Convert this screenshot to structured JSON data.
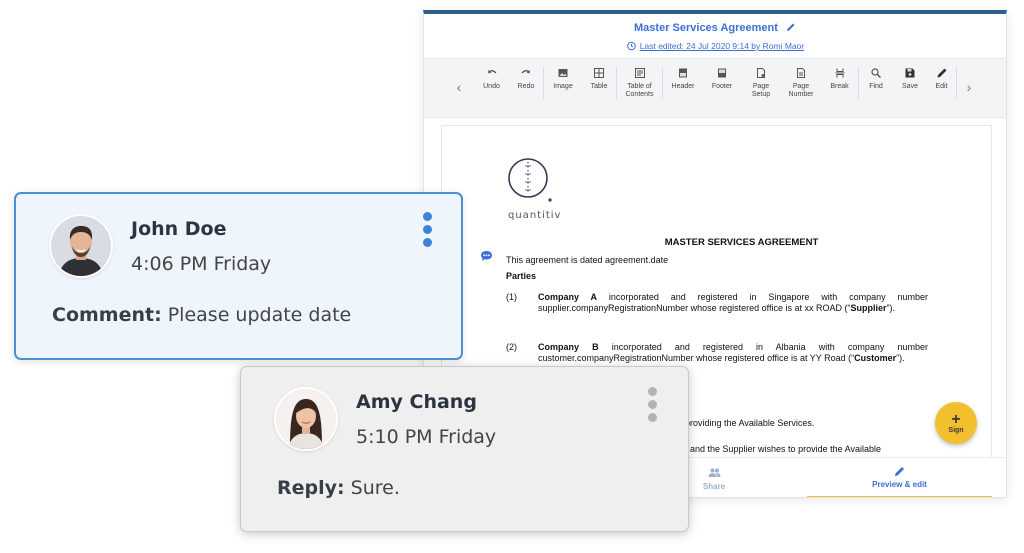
{
  "editor": {
    "doc_title": "Master Services Agreement",
    "last_edited": "Last edited: 24 Jul 2020 9:14 by Romi Maor",
    "toolbar": [
      {
        "id": "undo",
        "label": "Undo",
        "icon": "undo-icon"
      },
      {
        "id": "redo",
        "label": "Redo",
        "icon": "redo-icon"
      },
      {
        "id": "image",
        "label": "Image",
        "icon": "image-icon"
      },
      {
        "id": "table",
        "label": "Table",
        "icon": "table-icon"
      },
      {
        "id": "toc",
        "label": "Table of\nContents",
        "icon": "toc-icon"
      },
      {
        "id": "header",
        "label": "Header",
        "icon": "header-icon"
      },
      {
        "id": "footer",
        "label": "Footer",
        "icon": "footer-icon"
      },
      {
        "id": "page-setup",
        "label": "Page\nSetup",
        "icon": "page-setup-icon"
      },
      {
        "id": "page-number",
        "label": "Page\nNumber",
        "icon": "page-number-icon"
      },
      {
        "id": "break",
        "label": "Break",
        "icon": "break-icon"
      },
      {
        "id": "find",
        "label": "Find",
        "icon": "search-icon"
      },
      {
        "id": "save",
        "label": "Save",
        "icon": "save-icon"
      },
      {
        "id": "edit",
        "label": "Edit",
        "icon": "pencil-icon"
      }
    ],
    "document": {
      "logo_text": "quantitiv",
      "heading": "MASTER SERVICES AGREEMENT",
      "dated": "This agreement is dated agreement.date",
      "parties_label": "Parties",
      "clause1_num": "(1)",
      "clause1_bold": "Company A",
      "clause1_text": " incorporated and registered in Singapore with company number supplier.companyRegistrationNumber whose registered office is at xx ROAD (“",
      "clause1_term": "Supplier",
      "clause1_end": "”).",
      "clause2_num": "(2)",
      "clause2_bold": "Company B",
      "clause2_text": " incorporated and registered in Albania with company number customer.companyRegistrationNumber whose registered office is at YY Road (“",
      "clause2_term": "Customer",
      "clause2_end": "”).",
      "recital_fragment_1": "providing the Available Services.",
      "recital_fragment_2": "and the Supplier wishes to provide the Available"
    },
    "bottom_tabs": {
      "share": "Share",
      "preview": "Preview & edit"
    },
    "fab": {
      "plus": "+",
      "label": "Sign"
    }
  },
  "comments": {
    "john": {
      "name": "John Doe",
      "time": "4:06 PM Friday",
      "body_label": "Comment:",
      "body_text": " Please update date"
    },
    "amy": {
      "name": "Amy Chang",
      "time": "5:10 PM Friday",
      "body_label": "Reply:",
      "body_text": " Sure."
    }
  },
  "colors": {
    "accent_blue": "#3b6fd6",
    "top_border": "#2f5f86",
    "fab_yellow": "#f2bf2f",
    "comment_border": "#4e8fd4"
  }
}
